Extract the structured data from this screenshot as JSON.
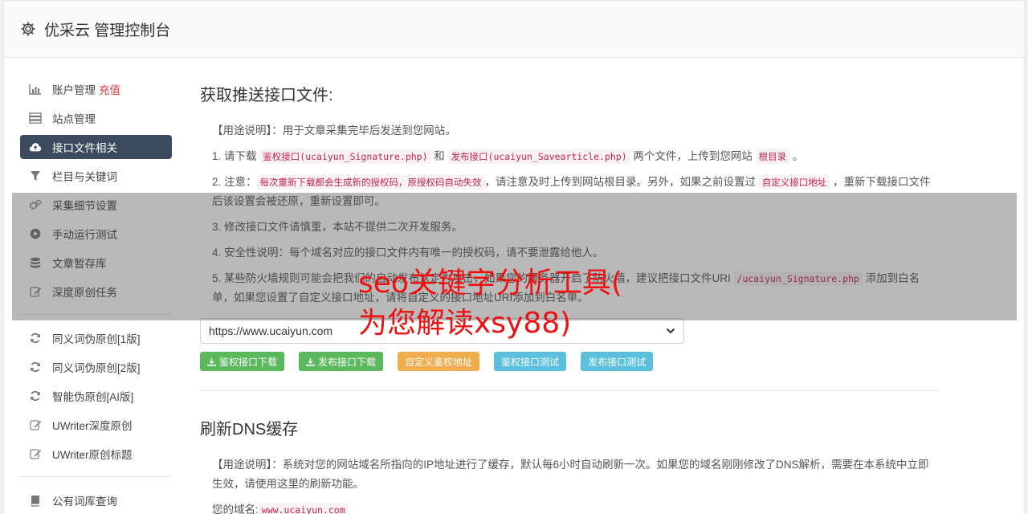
{
  "header": {
    "title": "优采云 管理控制台"
  },
  "sidebar": {
    "group1": [
      {
        "icon": "bar-chart-icon",
        "label": "账户管理",
        "highlight": "充值"
      },
      {
        "icon": "server-icon",
        "label": "站点管理"
      },
      {
        "icon": "cloud-upload-icon",
        "label": "接口文件相关",
        "active": true
      },
      {
        "icon": "filter-icon",
        "label": "栏目与关键词"
      },
      {
        "icon": "gears-icon",
        "label": "采集细节设置"
      },
      {
        "icon": "play-circle-icon",
        "label": "手动运行测试"
      },
      {
        "icon": "database-icon",
        "label": "文章暂存库"
      },
      {
        "icon": "edit-icon",
        "label": "深度原创任务"
      }
    ],
    "group2": [
      {
        "icon": "refresh-icon",
        "label": "同义词伪原创[1版]"
      },
      {
        "icon": "refresh-icon",
        "label": "同义词伪原创[2版]"
      },
      {
        "icon": "refresh-icon",
        "label": "智能伪原创[AI版]"
      },
      {
        "icon": "edit-icon",
        "label": "UWriter深度原创"
      },
      {
        "icon": "edit-icon",
        "label": "UWriter原创标题"
      }
    ],
    "group3": [
      {
        "icon": "book-icon",
        "label": "公有词库查询"
      }
    ]
  },
  "section1": {
    "title": "获取推送接口文件:",
    "usage": "【用途说明】：用于文章采集完毕后发送到您网站。",
    "step1": {
      "a": "1. 请下载 ",
      "code1": "鉴权接口(ucaiyun_Signature.php)",
      "b": " 和 ",
      "code2": "发布接口(ucaiyun_Savearticle.php)",
      "c": " 两个文件，上传到您网站 ",
      "code3": "根目录",
      "d": " 。"
    },
    "step2": {
      "a": "2. 注意：",
      "code1": "每次重新下载都会生成新的授权码，原授权码自动失效",
      "b": "，请注意及时上传到网站根目录。另外，如果之前设置过 ",
      "code2": "自定义接口地址",
      "c": " ，重新下载接口文件后该设置会被还原，重新设置即可。"
    },
    "step3": "3. 修改接口文件请慎重，本站不提供二次开发服务。",
    "step4": "4. 安全性说明：每个域名对应的接口文件内有唯一的授权码，请不要泄露给他人。",
    "step5": {
      "a": "5. 某些防火墙规则可能会把我们的自动发布认定为攻击，如果您的服务器开启了防火墙，建议把接口文件URI ",
      "code1": "/ucaiyun_Signature.php",
      "b": " 添加到白名单，如果您设置了自定义接口地址，请将自定义的接口地址URI添加到白名单。"
    },
    "select_value": "https://www.ucaiyun.com",
    "buttons": [
      {
        "label": "鉴权接口下载",
        "color": "#5cb85c",
        "icon": "download-icon"
      },
      {
        "label": "发布接口下载",
        "color": "#5cb85c",
        "icon": "download-icon"
      },
      {
        "label": "自定义鉴权地址",
        "color": "#f0ad4e"
      },
      {
        "label": "鉴权接口测试",
        "color": "#5bc0de"
      },
      {
        "label": "发布接口测试",
        "color": "#5bc0de"
      }
    ]
  },
  "section2": {
    "title": "刷新DNS缓存",
    "usage": "【用途说明】：系统对您的网站域名所指向的IP地址进行了缓存，默认每6小时自动刷新一次。如果您的域名刚刚修改了DNS解析，需要在本系统中立即生效，请使用这里的刷新功能。",
    "domain_label": "您的域名:",
    "domain_value": "www.ucaiyun.com"
  },
  "overlay": {
    "text": "seo关键字分析工具(\n为您解读xsy88)"
  }
}
